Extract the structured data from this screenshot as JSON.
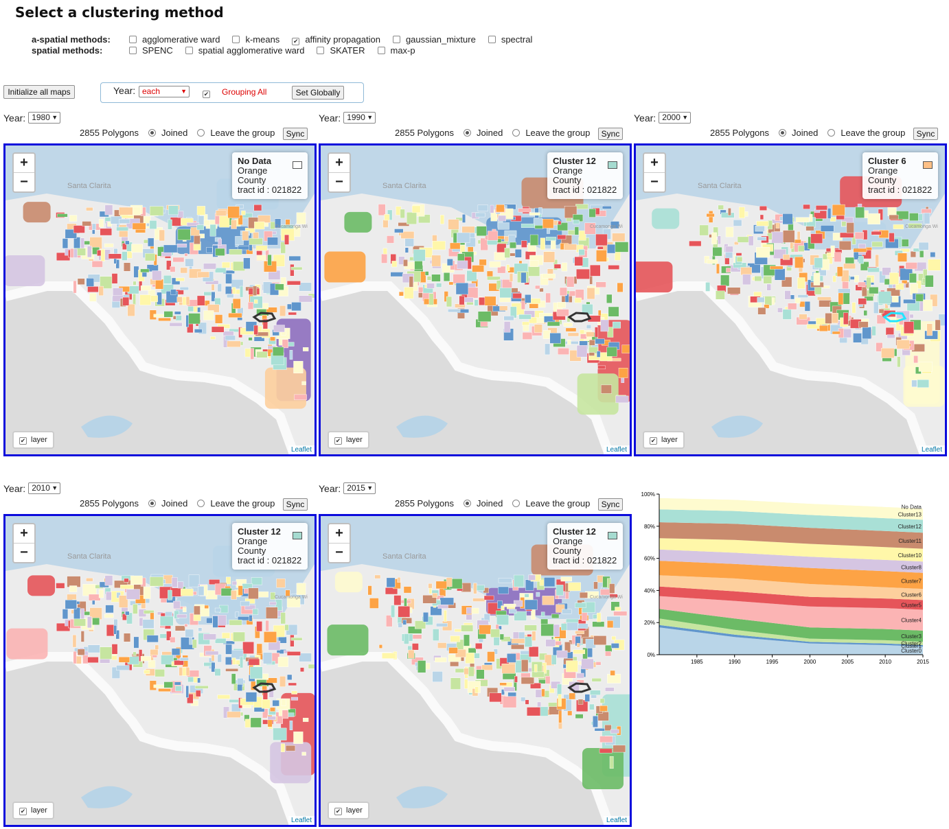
{
  "page": {
    "title": "Select a clustering method",
    "aspatial_label": "a-spatial methods:",
    "aspatial_methods": [
      {
        "label": "agglomerative ward",
        "checked": false
      },
      {
        "label": "k-means",
        "checked": false
      },
      {
        "label": "affinity propagation",
        "checked": true
      },
      {
        "label": "gaussian_mixture",
        "checked": false
      },
      {
        "label": "spectral",
        "checked": false
      }
    ],
    "spatial_label": "spatial methods:",
    "spatial_methods": [
      {
        "label": "SPENC",
        "checked": false
      },
      {
        "label": "spatial agglomerative ward",
        "checked": false
      },
      {
        "label": "SKATER",
        "checked": false
      },
      {
        "label": "max-p",
        "checked": false
      }
    ],
    "init_button": "Initialize all maps",
    "global": {
      "year_label": "Year:",
      "year_value": "each",
      "grouping_label": "Grouping All",
      "grouping_checked": true,
      "set_button": "Set Globally"
    }
  },
  "maps": [
    {
      "year_label": "Year:",
      "year": "1980",
      "polygons": "2855 Polygons",
      "joined": "Joined",
      "leave": "Leave the group",
      "sync": "Sync",
      "info": {
        "title": "No Data",
        "line1": "Orange",
        "line2": "County",
        "line3": "tract id : 021822",
        "swatch": "#ffffff"
      },
      "layer": "layer",
      "attribution": "Leaflet",
      "highlight": "#333333"
    },
    {
      "year_label": "Year:",
      "year": "1990",
      "polygons": "2855 Polygons",
      "joined": "Joined",
      "leave": "Leave the group",
      "sync": "Sync",
      "info": {
        "title": "Cluster 12",
        "line1": "Orange",
        "line2": "County",
        "line3": "tract id : 021822",
        "swatch": "#a6dbd0"
      },
      "layer": "layer",
      "attribution": "Leaflet",
      "highlight": "#333333"
    },
    {
      "year_label": "Year:",
      "year": "2000",
      "polygons": "2855 Polygons",
      "joined": "Joined",
      "leave": "Leave the group",
      "sync": "Sync",
      "info": {
        "title": "Cluster 6",
        "line1": "Orange",
        "line2": "County",
        "line3": "tract id : 021822",
        "swatch": "#fdc086"
      },
      "layer": "layer",
      "attribution": "Leaflet",
      "highlight": "#22e5ff"
    },
    {
      "year_label": "Year:",
      "year": "2010",
      "polygons": "2855 Polygons",
      "joined": "Joined",
      "leave": "Leave the group",
      "sync": "Sync",
      "info": {
        "title": "Cluster 12",
        "line1": "Orange",
        "line2": "County",
        "line3": "tract id : 021822",
        "swatch": "#a6dbd0"
      },
      "layer": "layer",
      "attribution": "Leaflet",
      "highlight": "#333333"
    },
    {
      "year_label": "Year:",
      "year": "2015",
      "polygons": "2855 Polygons",
      "joined": "Joined",
      "leave": "Leave the group",
      "sync": "Sync",
      "info": {
        "title": "Cluster 12",
        "line1": "Orange",
        "line2": "County",
        "line3": "tract id : 021822",
        "swatch": "#a6dbd0"
      },
      "layer": "layer",
      "attribution": "Leaflet",
      "highlight": "#333333"
    }
  ],
  "map_labels": {
    "santa_clarita": "Santa Clarita",
    "cucamonga": "Cucamonga Wi",
    "pleasant": "Pleasant Ridge Wi"
  },
  "chart_data": {
    "type": "area",
    "x": [
      1980,
      1990,
      2000,
      2010,
      2015
    ],
    "xticks": [
      "1985",
      "1990",
      "1995",
      "2000",
      "2005",
      "2010",
      "2015"
    ],
    "xtick_values": [
      1985,
      1990,
      1995,
      2000,
      2005,
      2010,
      2015
    ],
    "yticks": [
      "0%",
      "20%",
      "40%",
      "60%",
      "80%",
      "100%"
    ],
    "ylim": [
      0,
      100
    ],
    "series": [
      {
        "name": "Cluster0",
        "color": "#b9d5e8",
        "values": [
          17,
          11,
          7,
          6,
          5
        ]
      },
      {
        "name": "Cluster1",
        "color": "#6096cc",
        "values": [
          1.5,
          1.5,
          1,
          1,
          1
        ]
      },
      {
        "name": "Cluster2",
        "color": "#c6e5a0",
        "values": [
          4,
          3,
          2,
          2,
          2
        ]
      },
      {
        "name": "Cluster3",
        "color": "#6cbb66",
        "values": [
          6,
          7,
          7,
          7,
          7
        ]
      },
      {
        "name": "Cluster4",
        "color": "#fbb4b4",
        "values": [
          8,
          11,
          13,
          13,
          13
        ]
      },
      {
        "name": "Cluster5",
        "color": "#e6555a",
        "values": [
          6,
          6,
          6,
          6,
          6
        ]
      },
      {
        "name": "Cluster6",
        "color": "#fdcf9d",
        "values": [
          7,
          8,
          8,
          7,
          7
        ]
      },
      {
        "name": "Cluster7",
        "color": "#fda345",
        "values": [
          9,
          9,
          10,
          10,
          10
        ]
      },
      {
        "name": "Cluster8",
        "color": "#d5c5e2",
        "values": [
          7,
          7,
          7,
          7,
          7
        ]
      },
      {
        "name": "Cluster10",
        "color": "#fff7a9",
        "values": [
          7,
          8,
          8,
          8,
          8
        ]
      },
      {
        "name": "Cluster11",
        "color": "#c98b6e",
        "values": [
          10,
          10,
          10,
          10,
          10
        ]
      },
      {
        "name": "Cluster12",
        "color": "#a9e0d6",
        "values": [
          8,
          8,
          8,
          8,
          8
        ]
      },
      {
        "name": "Cluster13",
        "color": "#fefbcf",
        "values": [
          7,
          7,
          7,
          7,
          7
        ]
      },
      {
        "name": "No Data",
        "color": "#ffffff",
        "values": [
          2,
          2,
          2,
          2,
          2
        ]
      }
    ]
  }
}
